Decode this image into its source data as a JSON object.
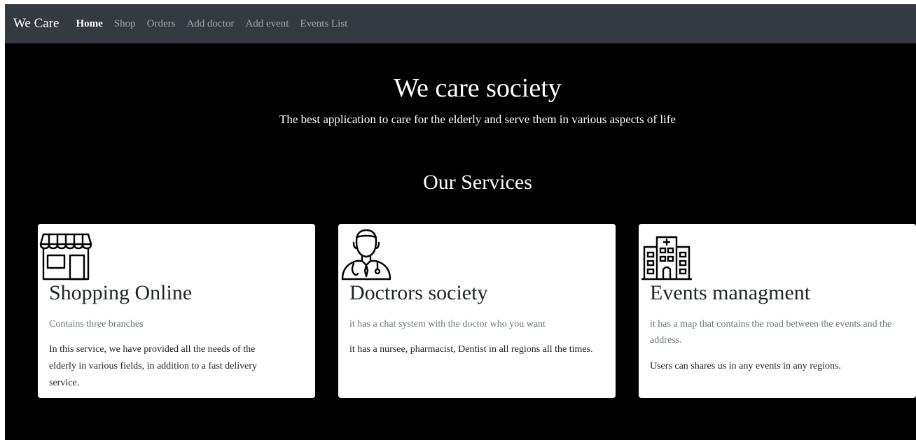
{
  "navbar": {
    "brand": "We Care",
    "links": [
      {
        "label": "Home",
        "active": true
      },
      {
        "label": "Shop",
        "active": false
      },
      {
        "label": "Orders",
        "active": false
      },
      {
        "label": "Add doctor",
        "active": false
      },
      {
        "label": "Add event",
        "active": false
      },
      {
        "label": "Events List",
        "active": false
      }
    ]
  },
  "hero": {
    "title": "We care society",
    "subtitle": "The best application to care for the elderly and serve them in various aspects of life"
  },
  "services": {
    "title": "Our Services",
    "cards": [
      {
        "icon": "store-icon",
        "title": "Shopping Online",
        "subtitle": "Contains three branches",
        "text": "In this service, we have provided all the needs of the elderly in various fields, in addition to a fast delivery service."
      },
      {
        "icon": "doctor-icon",
        "title": "Doctrors society",
        "subtitle": "it has a chat system with the doctor who you want",
        "text": "it has a nursee, pharmacist, Dentist in all regions all the times."
      },
      {
        "icon": "hospital-building-icon",
        "title": "Events managment",
        "subtitle": "it has a map that contains the road between the events and the address.",
        "text": "Users can shares us in any events in any regions."
      }
    ]
  },
  "colors": {
    "navbar_bg": "#343a40",
    "page_bg": "#000000",
    "card_bg": "#ffffff",
    "muted_text": "#6c757d"
  }
}
